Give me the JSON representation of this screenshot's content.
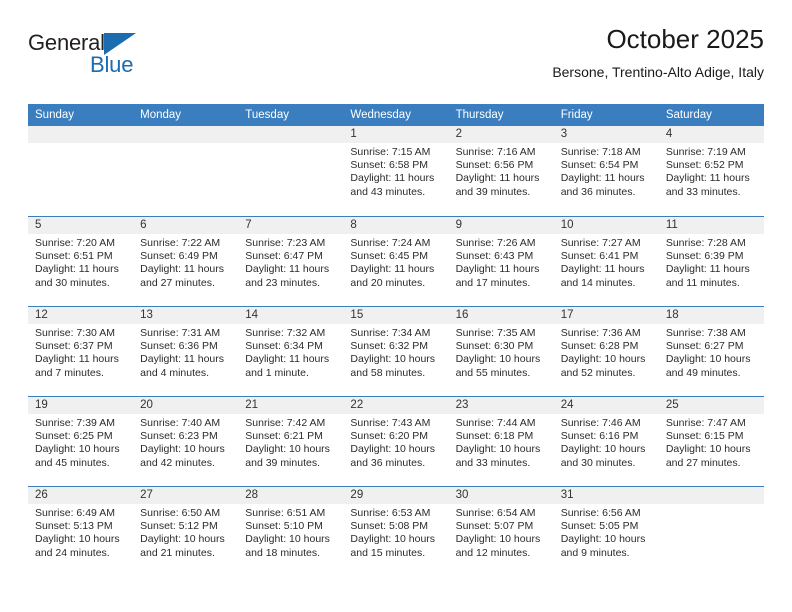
{
  "brand": {
    "name_part1": "General",
    "name_part2": "Blue",
    "triangle_color": "#1b6cb0"
  },
  "header": {
    "title": "October 2025",
    "subtitle": "Bersone, Trentino-Alto Adige, Italy"
  },
  "theme": {
    "header_blue": "#3a7ebf",
    "band_gray": "#f0f0f0",
    "text": "#2b2b2b"
  },
  "weekdays": [
    "Sunday",
    "Monday",
    "Tuesday",
    "Wednesday",
    "Thursday",
    "Friday",
    "Saturday"
  ],
  "labels": {
    "sunrise": "Sunrise:",
    "sunset": "Sunset:",
    "daylight": "Daylight:"
  },
  "weeks": [
    [
      {
        "day": ""
      },
      {
        "day": ""
      },
      {
        "day": ""
      },
      {
        "day": "1",
        "sunrise": "Sunrise: 7:15 AM",
        "sunset": "Sunset: 6:58 PM",
        "daylight_l1": "Daylight: 11 hours",
        "daylight_l2": "and 43 minutes."
      },
      {
        "day": "2",
        "sunrise": "Sunrise: 7:16 AM",
        "sunset": "Sunset: 6:56 PM",
        "daylight_l1": "Daylight: 11 hours",
        "daylight_l2": "and 39 minutes."
      },
      {
        "day": "3",
        "sunrise": "Sunrise: 7:18 AM",
        "sunset": "Sunset: 6:54 PM",
        "daylight_l1": "Daylight: 11 hours",
        "daylight_l2": "and 36 minutes."
      },
      {
        "day": "4",
        "sunrise": "Sunrise: 7:19 AM",
        "sunset": "Sunset: 6:52 PM",
        "daylight_l1": "Daylight: 11 hours",
        "daylight_l2": "and 33 minutes."
      }
    ],
    [
      {
        "day": "5",
        "sunrise": "Sunrise: 7:20 AM",
        "sunset": "Sunset: 6:51 PM",
        "daylight_l1": "Daylight: 11 hours",
        "daylight_l2": "and 30 minutes."
      },
      {
        "day": "6",
        "sunrise": "Sunrise: 7:22 AM",
        "sunset": "Sunset: 6:49 PM",
        "daylight_l1": "Daylight: 11 hours",
        "daylight_l2": "and 27 minutes."
      },
      {
        "day": "7",
        "sunrise": "Sunrise: 7:23 AM",
        "sunset": "Sunset: 6:47 PM",
        "daylight_l1": "Daylight: 11 hours",
        "daylight_l2": "and 23 minutes."
      },
      {
        "day": "8",
        "sunrise": "Sunrise: 7:24 AM",
        "sunset": "Sunset: 6:45 PM",
        "daylight_l1": "Daylight: 11 hours",
        "daylight_l2": "and 20 minutes."
      },
      {
        "day": "9",
        "sunrise": "Sunrise: 7:26 AM",
        "sunset": "Sunset: 6:43 PM",
        "daylight_l1": "Daylight: 11 hours",
        "daylight_l2": "and 17 minutes."
      },
      {
        "day": "10",
        "sunrise": "Sunrise: 7:27 AM",
        "sunset": "Sunset: 6:41 PM",
        "daylight_l1": "Daylight: 11 hours",
        "daylight_l2": "and 14 minutes."
      },
      {
        "day": "11",
        "sunrise": "Sunrise: 7:28 AM",
        "sunset": "Sunset: 6:39 PM",
        "daylight_l1": "Daylight: 11 hours",
        "daylight_l2": "and 11 minutes."
      }
    ],
    [
      {
        "day": "12",
        "sunrise": "Sunrise: 7:30 AM",
        "sunset": "Sunset: 6:37 PM",
        "daylight_l1": "Daylight: 11 hours",
        "daylight_l2": "and 7 minutes."
      },
      {
        "day": "13",
        "sunrise": "Sunrise: 7:31 AM",
        "sunset": "Sunset: 6:36 PM",
        "daylight_l1": "Daylight: 11 hours",
        "daylight_l2": "and 4 minutes."
      },
      {
        "day": "14",
        "sunrise": "Sunrise: 7:32 AM",
        "sunset": "Sunset: 6:34 PM",
        "daylight_l1": "Daylight: 11 hours",
        "daylight_l2": "and 1 minute."
      },
      {
        "day": "15",
        "sunrise": "Sunrise: 7:34 AM",
        "sunset": "Sunset: 6:32 PM",
        "daylight_l1": "Daylight: 10 hours",
        "daylight_l2": "and 58 minutes."
      },
      {
        "day": "16",
        "sunrise": "Sunrise: 7:35 AM",
        "sunset": "Sunset: 6:30 PM",
        "daylight_l1": "Daylight: 10 hours",
        "daylight_l2": "and 55 minutes."
      },
      {
        "day": "17",
        "sunrise": "Sunrise: 7:36 AM",
        "sunset": "Sunset: 6:28 PM",
        "daylight_l1": "Daylight: 10 hours",
        "daylight_l2": "and 52 minutes."
      },
      {
        "day": "18",
        "sunrise": "Sunrise: 7:38 AM",
        "sunset": "Sunset: 6:27 PM",
        "daylight_l1": "Daylight: 10 hours",
        "daylight_l2": "and 49 minutes."
      }
    ],
    [
      {
        "day": "19",
        "sunrise": "Sunrise: 7:39 AM",
        "sunset": "Sunset: 6:25 PM",
        "daylight_l1": "Daylight: 10 hours",
        "daylight_l2": "and 45 minutes."
      },
      {
        "day": "20",
        "sunrise": "Sunrise: 7:40 AM",
        "sunset": "Sunset: 6:23 PM",
        "daylight_l1": "Daylight: 10 hours",
        "daylight_l2": "and 42 minutes."
      },
      {
        "day": "21",
        "sunrise": "Sunrise: 7:42 AM",
        "sunset": "Sunset: 6:21 PM",
        "daylight_l1": "Daylight: 10 hours",
        "daylight_l2": "and 39 minutes."
      },
      {
        "day": "22",
        "sunrise": "Sunrise: 7:43 AM",
        "sunset": "Sunset: 6:20 PM",
        "daylight_l1": "Daylight: 10 hours",
        "daylight_l2": "and 36 minutes."
      },
      {
        "day": "23",
        "sunrise": "Sunrise: 7:44 AM",
        "sunset": "Sunset: 6:18 PM",
        "daylight_l1": "Daylight: 10 hours",
        "daylight_l2": "and 33 minutes."
      },
      {
        "day": "24",
        "sunrise": "Sunrise: 7:46 AM",
        "sunset": "Sunset: 6:16 PM",
        "daylight_l1": "Daylight: 10 hours",
        "daylight_l2": "and 30 minutes."
      },
      {
        "day": "25",
        "sunrise": "Sunrise: 7:47 AM",
        "sunset": "Sunset: 6:15 PM",
        "daylight_l1": "Daylight: 10 hours",
        "daylight_l2": "and 27 minutes."
      }
    ],
    [
      {
        "day": "26",
        "sunrise": "Sunrise: 6:49 AM",
        "sunset": "Sunset: 5:13 PM",
        "daylight_l1": "Daylight: 10 hours",
        "daylight_l2": "and 24 minutes."
      },
      {
        "day": "27",
        "sunrise": "Sunrise: 6:50 AM",
        "sunset": "Sunset: 5:12 PM",
        "daylight_l1": "Daylight: 10 hours",
        "daylight_l2": "and 21 minutes."
      },
      {
        "day": "28",
        "sunrise": "Sunrise: 6:51 AM",
        "sunset": "Sunset: 5:10 PM",
        "daylight_l1": "Daylight: 10 hours",
        "daylight_l2": "and 18 minutes."
      },
      {
        "day": "29",
        "sunrise": "Sunrise: 6:53 AM",
        "sunset": "Sunset: 5:08 PM",
        "daylight_l1": "Daylight: 10 hours",
        "daylight_l2": "and 15 minutes."
      },
      {
        "day": "30",
        "sunrise": "Sunrise: 6:54 AM",
        "sunset": "Sunset: 5:07 PM",
        "daylight_l1": "Daylight: 10 hours",
        "daylight_l2": "and 12 minutes."
      },
      {
        "day": "31",
        "sunrise": "Sunrise: 6:56 AM",
        "sunset": "Sunset: 5:05 PM",
        "daylight_l1": "Daylight: 10 hours",
        "daylight_l2": "and 9 minutes."
      },
      {
        "day": ""
      }
    ]
  ]
}
